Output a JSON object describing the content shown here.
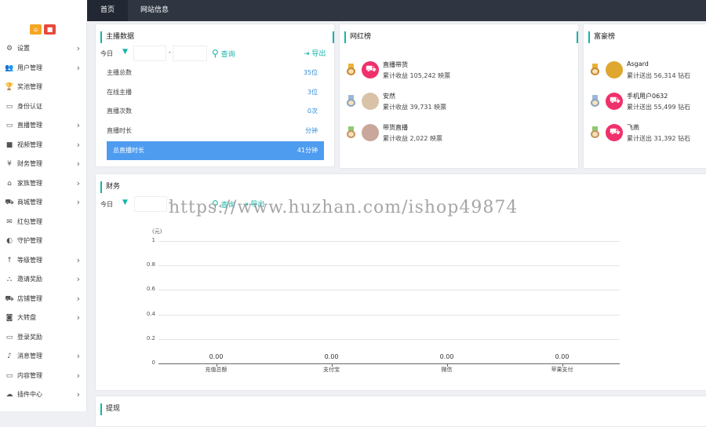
{
  "topbar": {
    "tabs": [
      {
        "label": "首页"
      },
      {
        "label": "网站信息"
      }
    ]
  },
  "sidebar": {
    "items": [
      {
        "label": "设置",
        "icon": "gear-icon",
        "chevron": "›"
      },
      {
        "label": "用户管理",
        "icon": "users-icon",
        "chevron": "›"
      },
      {
        "label": "奖池管理",
        "icon": "trophy-icon",
        "chevron": ""
      },
      {
        "label": "身份认证",
        "icon": "id-card-icon",
        "chevron": ""
      },
      {
        "label": "直播管理",
        "icon": "monitor-icon",
        "chevron": "›"
      },
      {
        "label": "视频管理",
        "icon": "video-icon",
        "chevron": "›"
      },
      {
        "label": "财务管理",
        "icon": "yen-icon",
        "chevron": "›"
      },
      {
        "label": "家族管理",
        "icon": "bank-icon",
        "chevron": "›"
      },
      {
        "label": "商城管理",
        "icon": "cart-icon",
        "chevron": "›"
      },
      {
        "label": "红包管理",
        "icon": "envelope-icon",
        "chevron": ""
      },
      {
        "label": "守护管理",
        "icon": "shield-icon",
        "chevron": ""
      },
      {
        "label": "等级管理",
        "icon": "level-icon",
        "chevron": "›"
      },
      {
        "label": "邀请奖励",
        "icon": "sitemap-icon",
        "chevron": "›"
      },
      {
        "label": "店铺管理",
        "icon": "shop-cart-icon",
        "chevron": "›"
      },
      {
        "label": "大转盘",
        "icon": "gamepad-icon",
        "chevron": "›"
      },
      {
        "label": "登录奖励",
        "icon": "screen-icon",
        "chevron": ""
      },
      {
        "label": "消息管理",
        "icon": "bell-icon",
        "chevron": "›"
      },
      {
        "label": "内容管理",
        "icon": "content-icon",
        "chevron": "›"
      },
      {
        "label": "插件中心",
        "icon": "cloud-icon",
        "chevron": "›"
      }
    ]
  },
  "anchor_panel": {
    "title": "主播数据",
    "range_label": "今日",
    "date_dash": "-",
    "search_label": "查询",
    "export_label": "导出",
    "rows": [
      {
        "label": "主播总数",
        "value": "35位"
      },
      {
        "label": "在线主播",
        "value": "3位"
      },
      {
        "label": "直播次数",
        "value": "0次"
      },
      {
        "label": "直播时长",
        "value": "分钟"
      },
      {
        "label": "总直播时长",
        "value": "41分钟"
      }
    ]
  },
  "celebrity_panel": {
    "title": "网红榜",
    "entries": [
      {
        "name": "直播带货",
        "stat": "累计收益 105,242 映票",
        "medal": "gold"
      },
      {
        "name": "安然",
        "stat": "累计收益 39,731 映票",
        "medal": "silver"
      },
      {
        "name": "带货直播",
        "stat": "累计收益 2,022 映票",
        "medal": "bronze"
      }
    ]
  },
  "rich_panel": {
    "title": "富豪榜",
    "entries": [
      {
        "name": "Asgard",
        "stat": "累计送出 56,314 钻石",
        "medal": "gold"
      },
      {
        "name": "手机用户0632",
        "stat": "累计送出 55,499 钻石",
        "medal": "silver"
      },
      {
        "name": "飞燕",
        "stat": "累计送出 31,392 钻石",
        "medal": "bronze"
      }
    ]
  },
  "finance_panel": {
    "title": "财务",
    "range_label": "今日",
    "date_dash": "-",
    "search_label": "查询",
    "export_label": "导出"
  },
  "bottom_panel": {
    "title": "提现"
  },
  "watermark": "https://www.huzhan.com/ishop49874",
  "colors": {
    "accent": "#13b5a8",
    "topbar": "#2f3642",
    "highlight_row": "#4e9cf0"
  },
  "chart_data": {
    "type": "bar",
    "unit_label": "(元)",
    "categories": [
      "充值总额",
      "支付宝",
      "微信",
      "苹果支付"
    ],
    "values": [
      0,
      0,
      0,
      0
    ],
    "value_labels": [
      "0.00",
      "0.00",
      "0.00",
      "0.00"
    ],
    "yticks": [
      "0",
      "0.2",
      "0.4",
      "0.6",
      "0.8",
      "1"
    ],
    "ylim": [
      0,
      1
    ],
    "grid": true
  }
}
